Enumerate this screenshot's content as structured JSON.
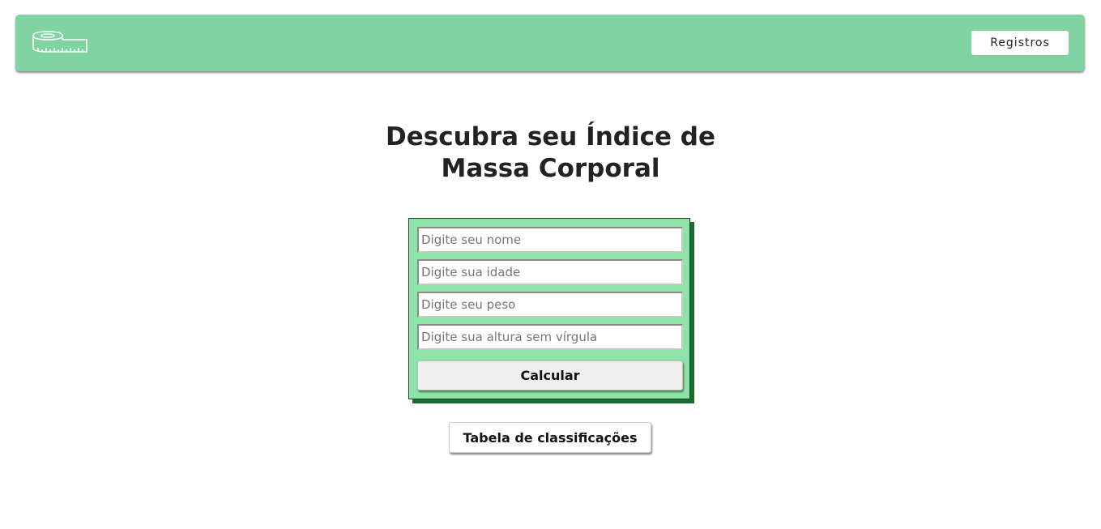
{
  "header": {
    "logo_icon": "measuring-tape-icon",
    "registros_label": "Registros",
    "bg_color": "#7fd4a1"
  },
  "main": {
    "title": "Descubra seu Índice de Massa Corporal",
    "form": {
      "name_placeholder": "Digite seu nome",
      "age_placeholder": "Digite sua idade",
      "weight_placeholder": "Digite seu peso",
      "height_placeholder": "Digite sua altura sem vírgula",
      "calculate_label": "Calcular",
      "bg_color": "#8de3a8"
    },
    "table_button_label": "Tabela de classificações"
  }
}
